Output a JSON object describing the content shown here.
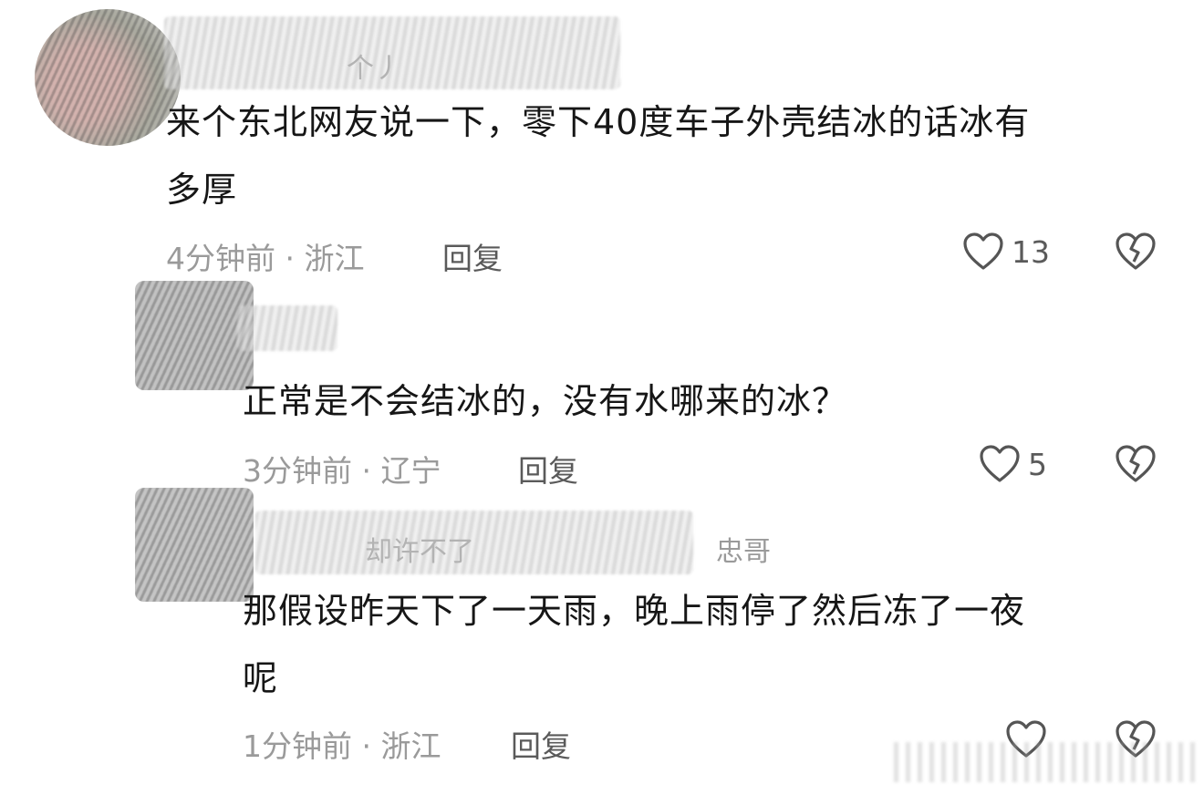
{
  "comments": [
    {
      "nickname": "个丿",
      "content_lines": [
        "来个东北网友说一下，零下40度车子外壳结冰的话冰有",
        "多厚"
      ],
      "time_location": "4分钟前 · 浙江",
      "reply_label": "回复",
      "likes": "13",
      "like_icon": "heart-outline-icon",
      "dislike_icon": "broken-heart-icon"
    },
    {
      "nickname": "",
      "content_lines": [
        "正常是不会结冰的，没有水哪来的冰？"
      ],
      "time_location": "3分钟前 · 辽宁",
      "reply_label": "回复",
      "likes": "5",
      "like_icon": "heart-outline-icon",
      "dislike_icon": "broken-heart-icon"
    },
    {
      "nickname": "却许不了",
      "reply_to": "忠哥",
      "content_lines": [
        "那假设昨天下了一天雨，晚上雨停了然后冻了一夜",
        "呢"
      ],
      "time_location": "1分钟前 · 浙江",
      "reply_label": "回复",
      "likes": "",
      "like_icon": "heart-outline-icon",
      "dislike_icon": "broken-heart-icon"
    }
  ],
  "colors": {
    "text": "#161616",
    "meta": "#9a9a9a",
    "action": "#5a5a5a"
  }
}
